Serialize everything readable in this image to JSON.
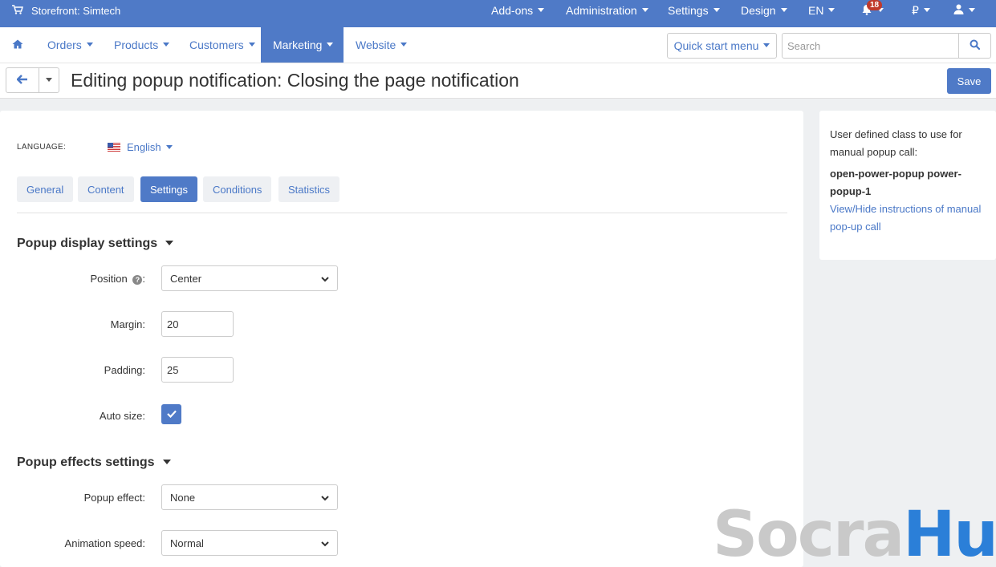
{
  "topbar": {
    "store_label": "Storefront: Simtech",
    "menus": [
      "Add-ons",
      "Administration",
      "Settings",
      "Design",
      "EN"
    ],
    "notifications_count": "18",
    "currency": "₽"
  },
  "nav": {
    "items": [
      "Orders",
      "Products",
      "Customers",
      "Marketing",
      "Website"
    ],
    "active": "Marketing",
    "quick_start": "Quick start menu",
    "search_placeholder": "Search"
  },
  "titlebar": {
    "title": "Editing popup notification: Closing the page notification",
    "save": "Save"
  },
  "language": {
    "label": "LANGUAGE:",
    "value": "English"
  },
  "tabs": [
    "General",
    "Content",
    "Settings",
    "Conditions",
    "Statistics"
  ],
  "active_tab": "Settings",
  "display_section": {
    "title": "Popup display settings",
    "position_label": "Position",
    "position_value": "Center",
    "margin_label": "Margin:",
    "margin_value": "20",
    "padding_label": "Padding:",
    "padding_value": "25",
    "autosize_label": "Auto size:",
    "autosize_checked": true
  },
  "effects_section": {
    "title": "Popup effects settings",
    "effect_label": "Popup effect:",
    "effect_value": "None",
    "speed_label": "Animation speed:",
    "speed_value": "Normal"
  },
  "sidebar": {
    "text": "User defined class to use for manual popup call:",
    "class_name": "open-power-popup power-popup-1",
    "link": "View/Hide instructions of manual pop-up call"
  },
  "watermark": {
    "part1": "Socra",
    "part2": "Hub"
  },
  "colors": {
    "primary": "#4f7ac7",
    "link": "#4a78c7",
    "badge": "#c0392b"
  }
}
